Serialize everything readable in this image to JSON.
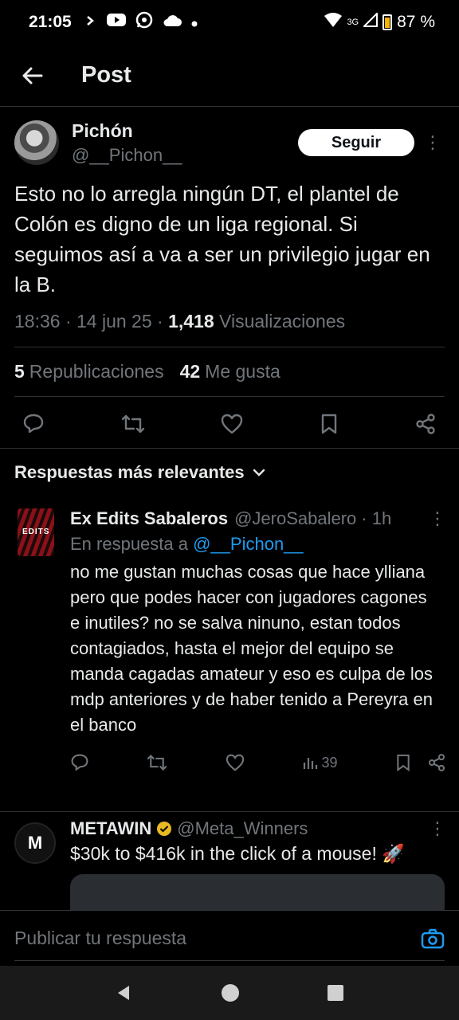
{
  "status_bar": {
    "time": "21:05",
    "network": "3G",
    "battery": "87 %"
  },
  "header": {
    "title": "Post"
  },
  "post": {
    "author_name": "Pichón",
    "author_handle": "@__Pichon__",
    "follow_label": "Seguir",
    "text": "Esto no lo arregla ningún DT, el plantel de Colón es digno de un liga regional. Si seguimos así a va a ser un privilegio jugar en la B.",
    "time": "18:36 · 14 jun 25 · ",
    "views_count": "1,418",
    "views_label": " Visualizaciones",
    "reposts_count": "5",
    "reposts_label": "Republicaciones",
    "likes_count": "42",
    "likes_label": "Me gusta"
  },
  "replies_section": {
    "title": "Respuestas más relevantes"
  },
  "reply": {
    "author_name": "Ex Edits Sabaleros",
    "author_handle": "@JeroSabalero",
    "age": "· 1h",
    "in_reply_prefix": "En respuesta a ",
    "in_reply_handle": "@__Pichon__",
    "text": "no me gustan muchas cosas que hace ylliana pero que podes hacer con jugadores cagones e inutiles? no se salva ninuno, estan todos contagiados, hasta el mejor del equipo se manda cagadas amateur y eso es culpa de los mdp anteriores y de haber tenido a Pereyra en el banco",
    "views": "39",
    "avatar_text": "EDITS"
  },
  "ad": {
    "author_name": "METAWIN",
    "author_handle": "@Meta_Winners",
    "text": "$30k to $416k in the click of a mouse! 🚀",
    "avatar_text": "M"
  },
  "reply_bar": {
    "placeholder": "Publicar tu respuesta"
  },
  "colors": {
    "background": "#000000",
    "text": "#e7e9ea",
    "muted": "#71767b",
    "accent": "#1d9bf0",
    "divider": "#2f3336"
  }
}
